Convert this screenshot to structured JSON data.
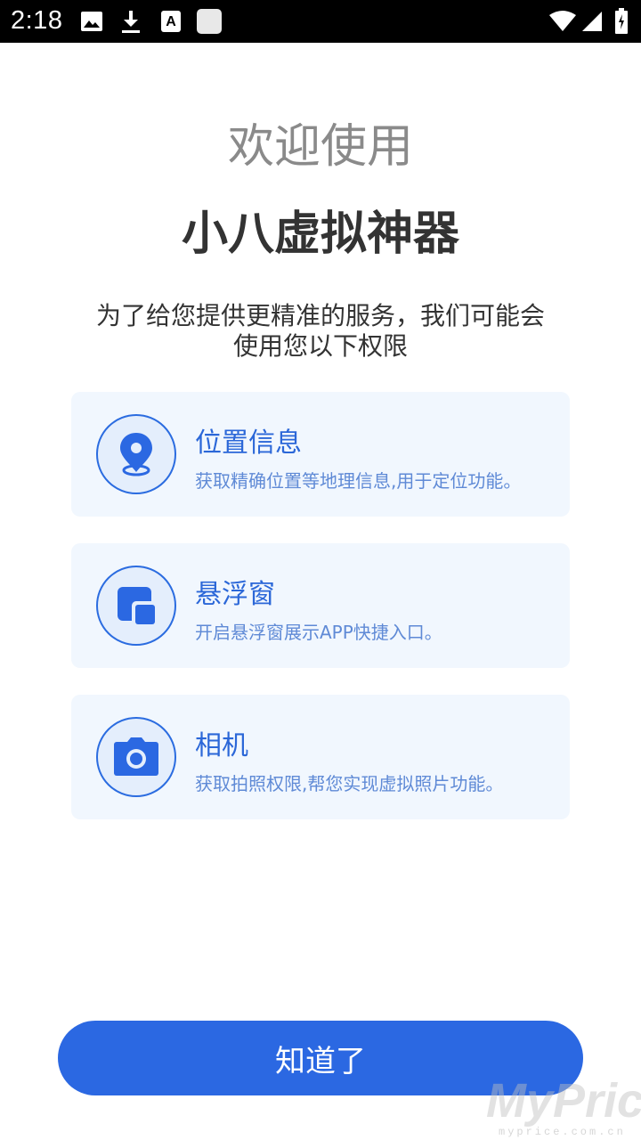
{
  "status_bar": {
    "time": "2:18",
    "left_icons": [
      "image-icon",
      "download-icon",
      "font-a-icon",
      "blank-square-icon"
    ],
    "right_icons": [
      "wifi-icon",
      "signal-icon",
      "battery-icon"
    ]
  },
  "header": {
    "welcome": "欢迎使用",
    "app_name": "小八虚拟神器"
  },
  "intro": {
    "line1": "为了给您提供更精准的服务，我们可能会",
    "line2": "使用您以下权限"
  },
  "permissions": [
    {
      "icon": "location-pin-icon",
      "title": "位置信息",
      "description": "获取精确位置等地理信息,用于定位功能。"
    },
    {
      "icon": "floating-window-icon",
      "title": "悬浮窗",
      "description": "开启悬浮窗展示APP快捷入口。"
    },
    {
      "icon": "camera-icon",
      "title": "相机",
      "description": "获取拍照权限,帮您实现虚拟照片功能。"
    }
  ],
  "confirm_button": {
    "label": "知道了"
  },
  "watermark": {
    "brand": "MyPrice",
    "url": "myprice.com.cn"
  },
  "colors": {
    "accent": "#2b68e2",
    "card_background": "#f1f7fe",
    "card_title": "#2b67d8",
    "card_description": "#5f8ad6",
    "welcome_text": "#8a8a8a",
    "app_name_text": "#333333"
  }
}
